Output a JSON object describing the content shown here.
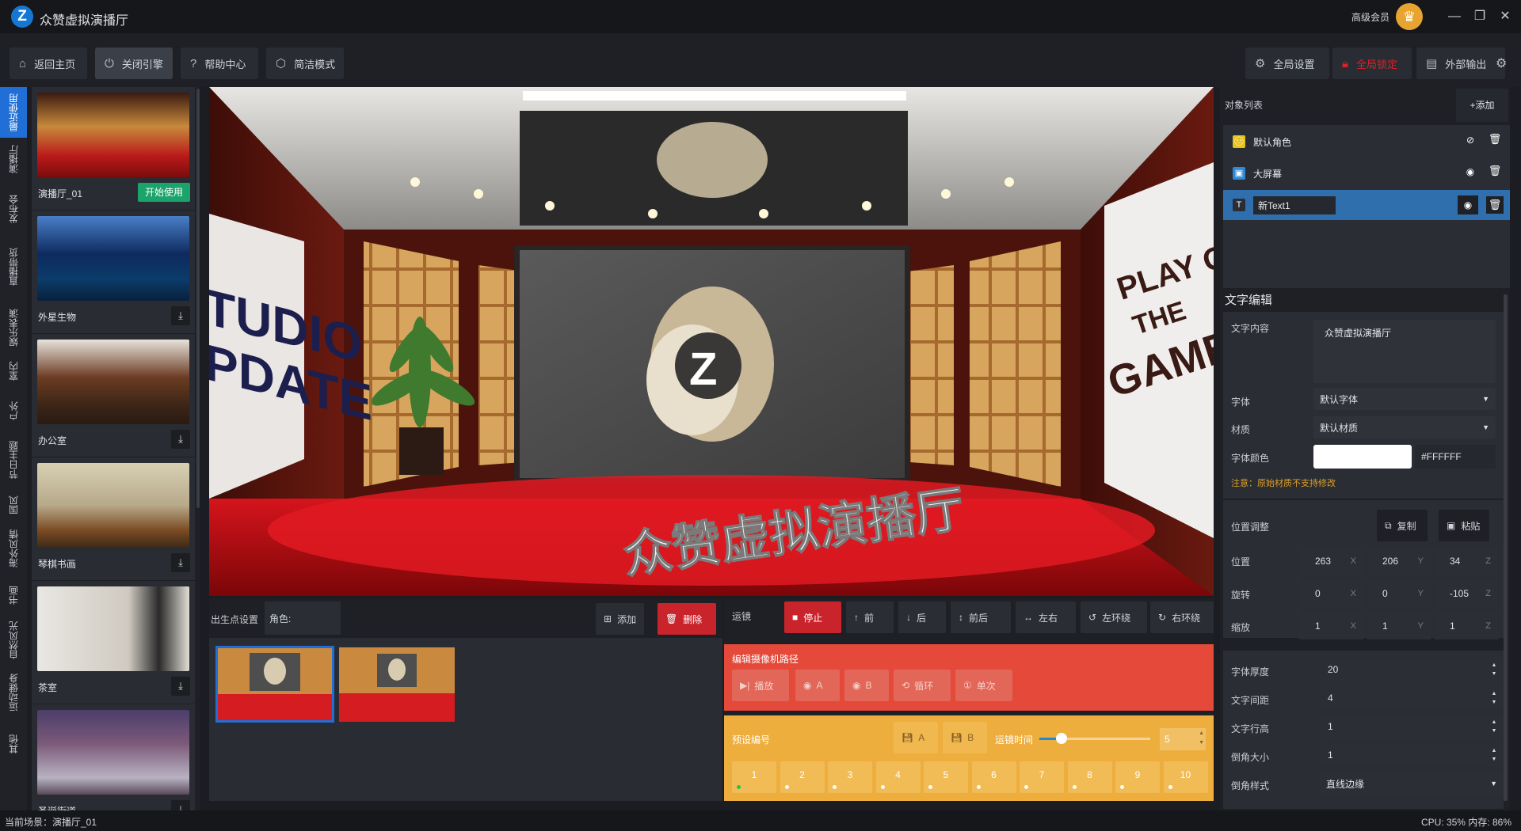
{
  "app": {
    "title": "众赞虚拟演播厅",
    "logo_letter": "Z",
    "member_label": "高级会员"
  },
  "window_controls": {
    "minimize": "—",
    "maximize": "❐",
    "close": "✕"
  },
  "toolbar": {
    "home": "返回主页",
    "close_engine": "关闭引擎",
    "help": "帮助中心",
    "simple_mode": "简洁模式",
    "global_settings": "全局设置",
    "global_lock": "全局锁定",
    "external_output": "外部输出"
  },
  "left_nav": [
    "最近使用",
    "演播厅",
    "发布会",
    "直播带货",
    "娱乐表演",
    "室内",
    "户外",
    "节日主题",
    "国风",
    "海外风情",
    "书画",
    "自然风光",
    "运动健身",
    "其他"
  ],
  "scenes": [
    {
      "name": "演播厅_01",
      "action": "开始使用"
    },
    {
      "name": "外星生物",
      "action": "download"
    },
    {
      "name": "办公室",
      "action": "download"
    },
    {
      "name": "琴棋书画",
      "action": "download"
    },
    {
      "name": "茶室",
      "action": "download"
    },
    {
      "name": "圣诞街道",
      "action": "download"
    }
  ],
  "preview": {
    "overlay_text": "众赞虚拟演播厅",
    "wall_left_text_1": "TUDIO",
    "wall_left_text_2": "PDATE",
    "wall_right_text_1": "PLAY OF",
    "wall_right_text_2": "THE",
    "wall_right_text_3": "GAME",
    "screen_letter": "Z"
  },
  "spawn": {
    "title": "出生点设置",
    "role_label": "角色:",
    "add": "添加",
    "delete": "删除"
  },
  "move": {
    "title": "运镜",
    "stop": "停止",
    "forward": "前",
    "back": "后",
    "front_back": "前后",
    "left_right": "左右",
    "orbit_left": "左环绕",
    "orbit_right": "右环绕",
    "edit_path_title": "编辑摄像机路径",
    "play": "播放",
    "point_a": "A",
    "point_b": "B",
    "loop": "循环",
    "once": "单次",
    "preset_title": "预设编号",
    "save_a": "A",
    "save_b": "B",
    "duration_label": "运镜时间",
    "duration_value": "5",
    "duration_slider": 0.2,
    "presets": [
      "1",
      "2",
      "3",
      "4",
      "5",
      "6",
      "7",
      "8",
      "9",
      "10"
    ],
    "active_preset": "1"
  },
  "objects": {
    "title": "对象列表",
    "add": "+添加",
    "items": [
      {
        "name": "默认角色",
        "visible": false
      },
      {
        "name": "大屏幕",
        "visible": true
      },
      {
        "name": "新Text1",
        "visible": true,
        "selected": true
      }
    ]
  },
  "text_edit": {
    "title": "文字编辑",
    "content_label": "文字内容",
    "content_value": "众赞虚拟演播厅",
    "font_label": "字体",
    "font_value": "默认字体",
    "material_label": "材质",
    "material_value": "默认材质",
    "color_label": "字体颜色",
    "color_hex": "#FFFFFF",
    "note": "注意：原始材质不支持修改"
  },
  "position": {
    "title": "位置调整",
    "copy": "复制",
    "paste": "粘贴",
    "position_label": "位置",
    "rotation_label": "旋转",
    "scale_label": "缩放",
    "position": [
      "263",
      "206",
      "34"
    ],
    "rotation": [
      "0",
      "0",
      "-105"
    ],
    "scale": [
      "1",
      "1",
      "1"
    ],
    "axes": [
      "X",
      "Y",
      "Z"
    ]
  },
  "text_props": [
    {
      "label": "字体厚度",
      "value": "20"
    },
    {
      "label": "文字间距",
      "value": "4"
    },
    {
      "label": "文字行高",
      "value": "1"
    },
    {
      "label": "倒角大小",
      "value": "1"
    }
  ],
  "bevel_style": {
    "label": "倒角样式",
    "value": "直线边缘"
  },
  "status": {
    "current_scene": "当前场景：演播厅_01",
    "cpu_mem": "CPU: 35% 内存: 86%"
  },
  "colors": {
    "accent_blue": "#1f6fd6",
    "start_green": "#1aa36a",
    "red": "#c9242b",
    "path_panel": "#e4493a",
    "preset_panel": "#eeae3e"
  }
}
